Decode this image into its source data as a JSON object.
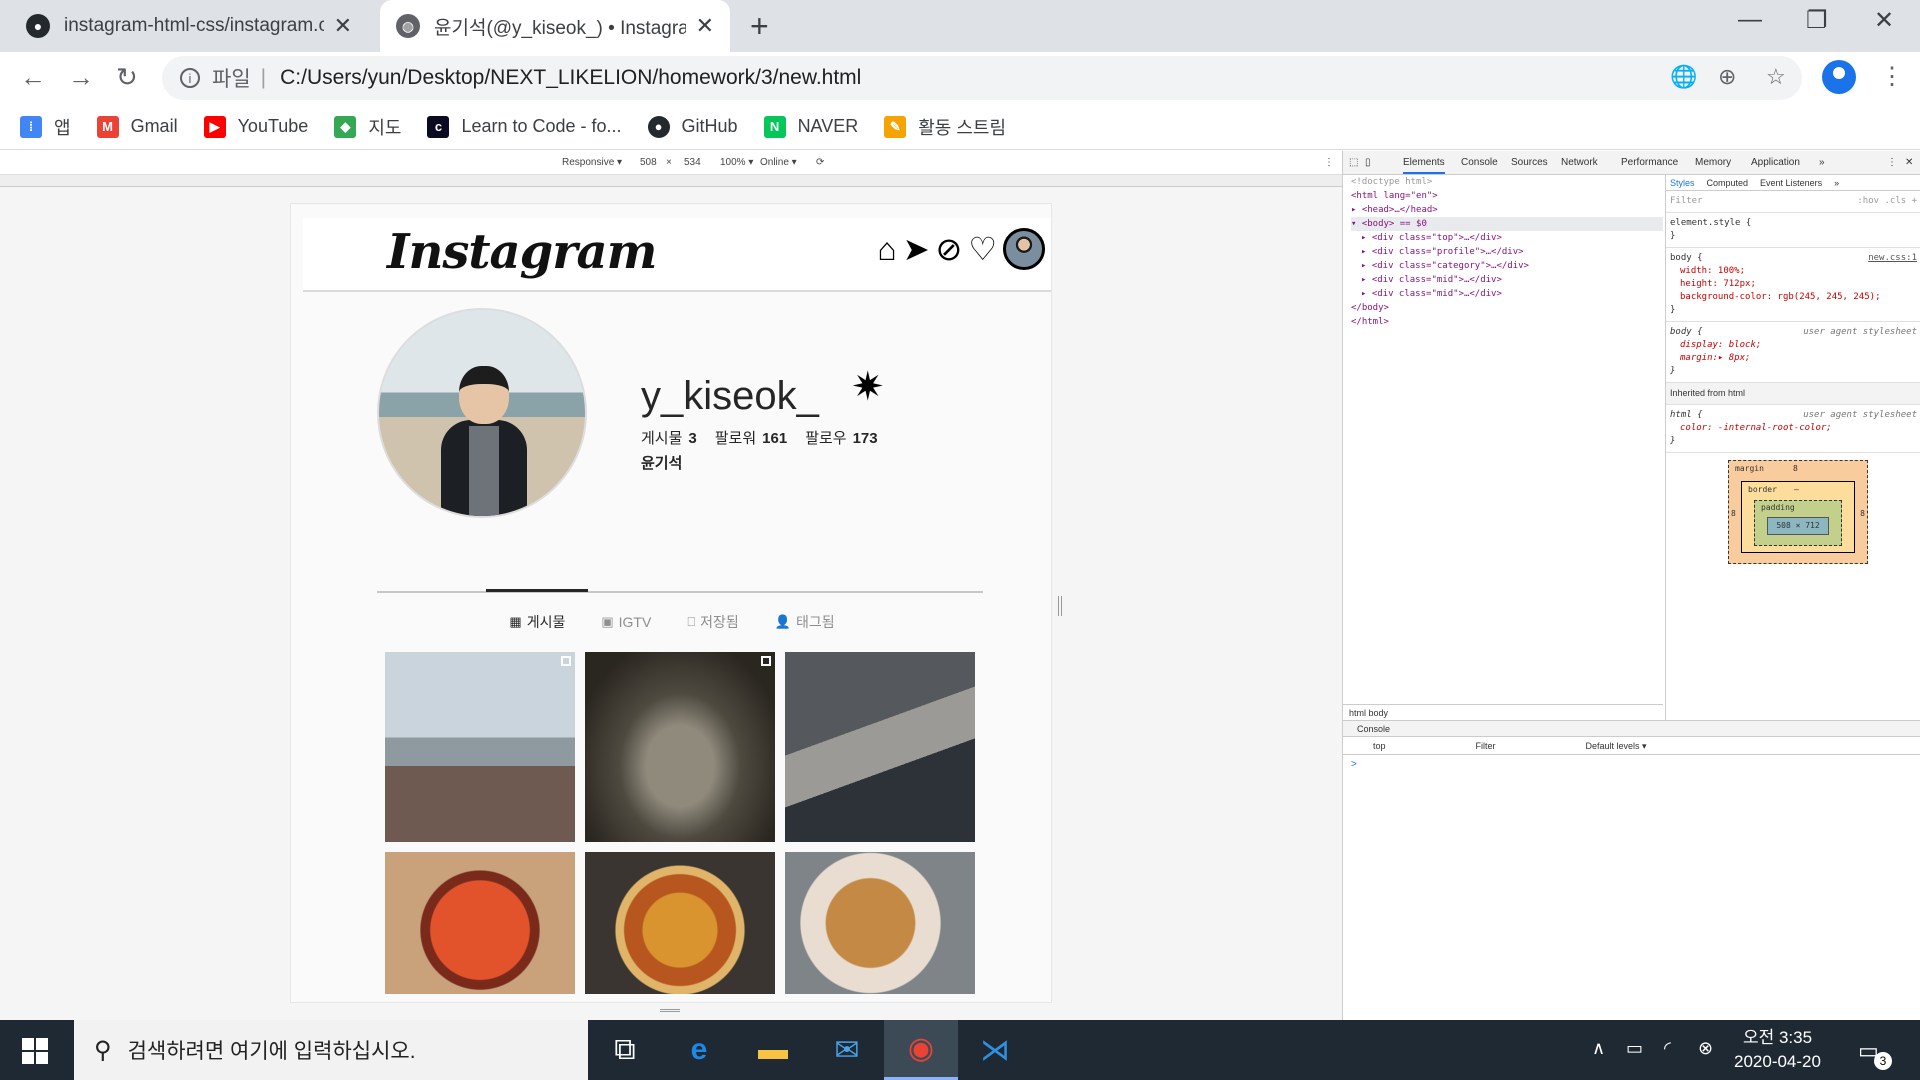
{
  "browser": {
    "tabs": [
      {
        "title": "instagram-html-css/instagram.css",
        "active": false,
        "icon": "github-icon"
      },
      {
        "title": "윤기석(@y_kiseok_) • Instagram",
        "active": true,
        "icon": "globe-icon"
      }
    ],
    "new_tab": "+",
    "window_controls": {
      "minimize": "—",
      "restore": "❐",
      "close": "✕"
    },
    "nav": {
      "back": "←",
      "forward": "→",
      "reload": "↻"
    },
    "address": {
      "scheme_label": "파일",
      "separator": "|",
      "url": "C:/Users/yun/Desktop/NEXT_LIKELION/homework/3/new.html"
    },
    "omnibox_icons": {
      "translate": "🌐",
      "zoom": "⊕",
      "bookmark": "☆"
    },
    "menu": "⋮"
  },
  "bookmarks": [
    {
      "label": "앱",
      "icon": "apps-icon",
      "color": "#4285f4"
    },
    {
      "label": "Gmail",
      "icon": "gmail-icon",
      "color": "#ea4335"
    },
    {
      "label": "YouTube",
      "icon": "youtube-icon",
      "color": "#ff0000"
    },
    {
      "label": "지도",
      "icon": "maps-icon",
      "color": "#34a853"
    },
    {
      "label": "Learn to Code - fo...",
      "icon": "freecodecamp-icon",
      "color": "#0a0a23"
    },
    {
      "label": "GitHub",
      "icon": "github-icon",
      "color": "#24292e"
    },
    {
      "label": "NAVER",
      "icon": "naver-icon",
      "color": "#03c75a"
    },
    {
      "label": "활동 스트림",
      "icon": "activity-stream-icon",
      "color": "#f4a300"
    }
  ],
  "device_toolbar": {
    "mode": "Responsive ▾",
    "width": "508",
    "times": "×",
    "height": "534",
    "zoom": "100% ▾",
    "network": "Online ▾"
  },
  "instagram": {
    "logo": "Instagram",
    "nav_icons": [
      "home-icon",
      "direct-icon",
      "explore-icon",
      "heart-icon"
    ],
    "username": "y_kiseok_",
    "settings_glyph": "✷",
    "stats": [
      {
        "label": "게시물",
        "value": "3"
      },
      {
        "label": "팔로워",
        "value": "161"
      },
      {
        "label": "팔로우",
        "value": "173"
      }
    ],
    "full_name": "윤기석",
    "tabs": [
      {
        "label": "게시물",
        "glyph": "▦",
        "active": true
      },
      {
        "label": "IGTV",
        "glyph": "▣",
        "active": false
      },
      {
        "label": "저장됨",
        "glyph": "⎕",
        "active": false
      },
      {
        "label": "태그됨",
        "glyph": "👤",
        "active": false
      }
    ],
    "posts": [
      {
        "name": "post-selfie-beach",
        "multi": true,
        "bg": "linear-gradient(180deg,#c9d4dc 0 45%,#8e9a9f 45% 60%,#6e5a50 60%)"
      },
      {
        "name": "post-cave",
        "multi": true,
        "bg": "radial-gradient(ellipse at 50% 60%,#8f8a7c 0 25%,#4f4a40 45%,#2a2620 80%)"
      },
      {
        "name": "post-group-selfie",
        "multi": false,
        "bg": "linear-gradient(160deg,#55585c 0 40%,#9b9a97 40% 60%,#2d3138 60%)"
      },
      {
        "name": "post-tteokbokki",
        "multi": false,
        "bg": "radial-gradient(circle at 50% 55%,#e2532b 0 40%,#7a2a1a 41% 48%,#c9a27c 49%)"
      },
      {
        "name": "post-pizza",
        "multi": false,
        "bg": "radial-gradient(circle at 50% 55%,#d9932f 0 30%,#b7571f 31% 45%,#e0b56a 46% 52%,#3a3530 53%)"
      },
      {
        "name": "post-fried-chicken",
        "multi": false,
        "bg": "radial-gradient(circle at 45% 50%,#c48a45 0 35%,#e8ddd0 36% 55%,#7f8489 56%)"
      }
    ]
  },
  "devtools": {
    "tabs": [
      "Elements",
      "Console",
      "Sources",
      "Network",
      "Performance",
      "Memory",
      "Application",
      "»"
    ],
    "dom": [
      "<!doctype html>",
      "<html lang=\"en\">",
      "▸ <head>…</head>",
      "▾ <body> == $0",
      "  ▸ <div class=\"top\">…</div>",
      "  ▸ <div class=\"profile\">…</div>",
      "  ▸ <div class=\"category\">…</div>",
      "  ▸ <div class=\"mid\">…</div>",
      "  ▸ <div class=\"mid\">…</div>",
      "  </body>",
      "</html>"
    ],
    "breadcrumbs": "html   body",
    "styles_tabs": [
      "Styles",
      "Computed",
      "Event Listeners",
      "»"
    ],
    "filter_placeholder": "Filter",
    "hov_cls": ":hov  .cls  +",
    "rules": [
      {
        "selector": "element.style {",
        "lines": [
          "}"
        ],
        "source": ""
      },
      {
        "selector": "body {",
        "lines": [
          "width: 100%;",
          "height: 712px;",
          "background-color: rgb(245, 245, 245);",
          "}"
        ],
        "source": "new.css:1"
      },
      {
        "selector": "body {",
        "lines": [
          "display: block;",
          "margin:▸ 8px;",
          "}"
        ],
        "source": "user agent stylesheet"
      },
      {
        "selector": "Inherited from html",
        "lines": [],
        "source": ""
      },
      {
        "selector": "html {",
        "lines": [
          "color: -internal-root-color;",
          "}"
        ],
        "source": "user agent stylesheet"
      }
    ],
    "box_model": {
      "margin": "margin",
      "margin_val": "8",
      "border": "border",
      "border_val": "–",
      "padding": "padding",
      "padding_val": "–",
      "content": "508 × 712",
      "side": "8"
    },
    "console_title": "Console",
    "console_context": "top",
    "console_filter": "Filter",
    "console_levels": "Default levels ▾",
    "prompt": ">"
  },
  "taskbar": {
    "search_placeholder": "검색하려면 여기에 입력하십시오.",
    "apps": [
      "task-view-icon",
      "edge-icon",
      "file-explorer-icon",
      "mail-icon",
      "chrome-icon",
      "vscode-icon"
    ],
    "time": "오전 3:35",
    "date": "2020-04-20",
    "notifications": "3"
  }
}
